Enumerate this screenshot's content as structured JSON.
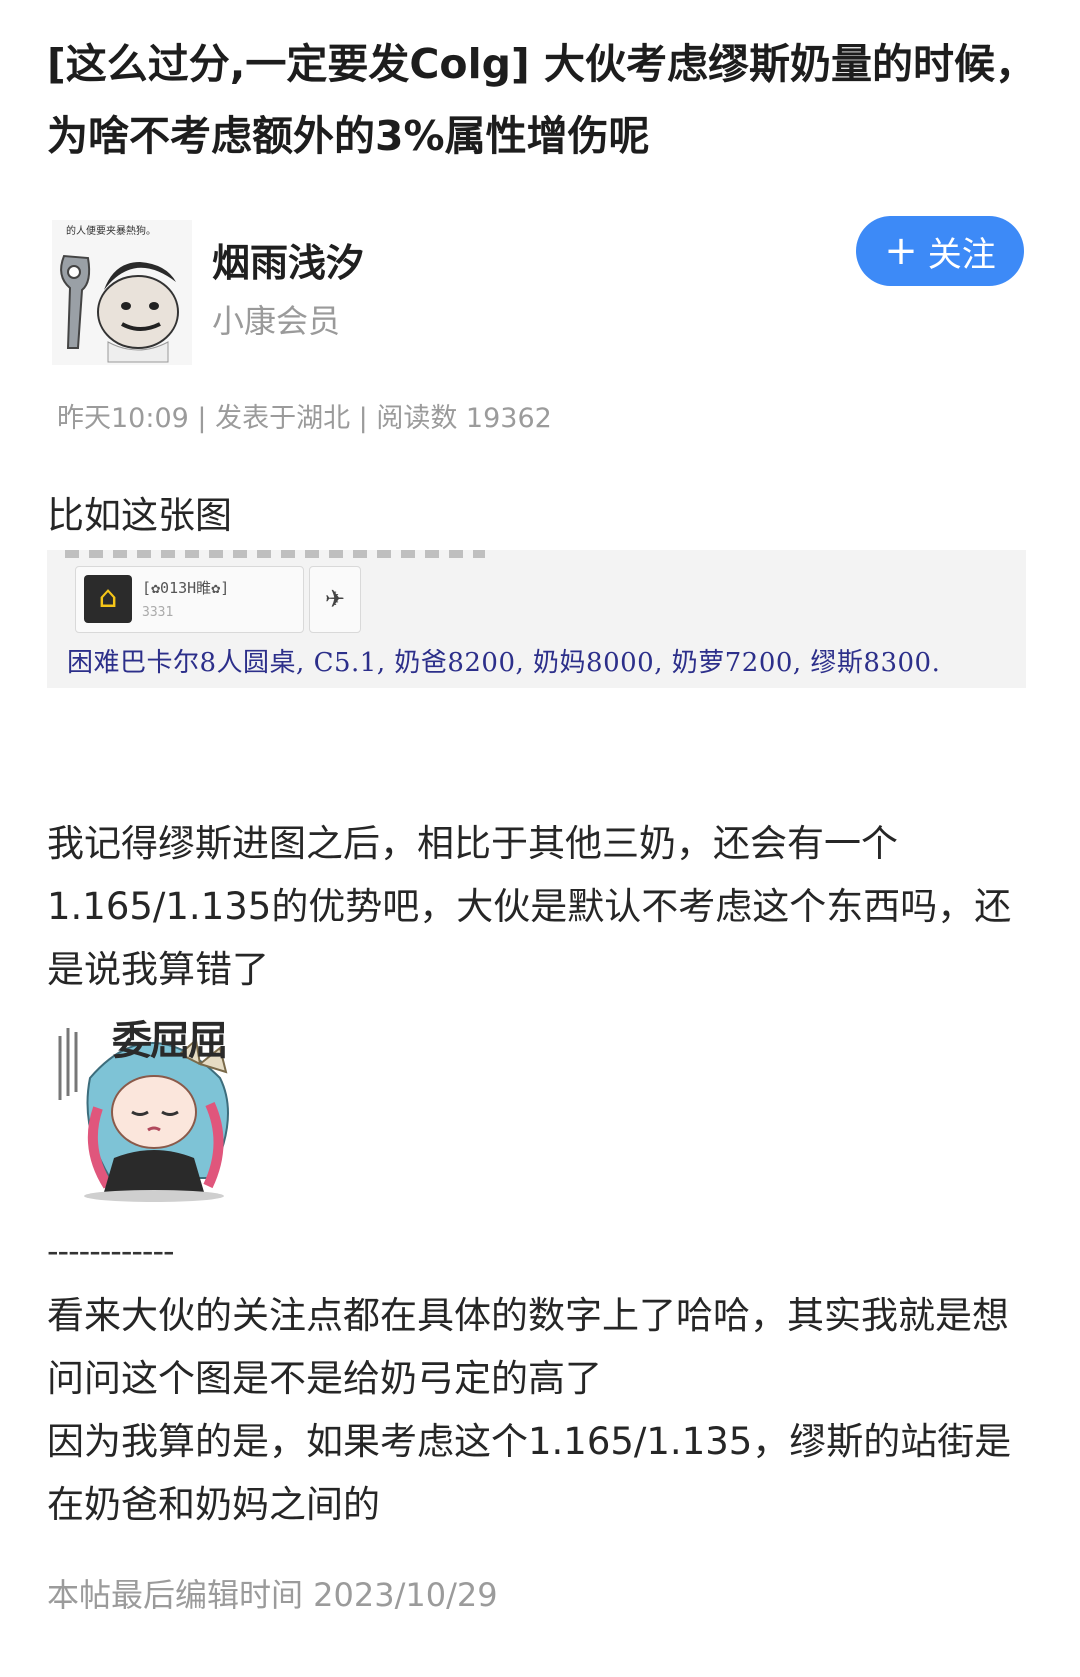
{
  "post": {
    "title": "[这么过分,一定要发Colg] 大伙考虑缪斯奶量的时候，为啥不考虑额外的3%属性增伤呢",
    "author": {
      "name": "烟雨浅汐",
      "level": "小康会员",
      "avatar_caption": "的人便要夹暴熱狗。"
    },
    "follow_label": "关注",
    "meta": "昨天10:09 | 发表于湖北 | 阅读数 19362",
    "paragraph_1": "比如这张图",
    "screenshot": {
      "chip_name": "[✿013H睢✿]",
      "chip_sub": "3331",
      "game_line": "困难巴卡尔8人圆桌, C5.1, 奶爸8200, 奶妈8000, 奶萝7200, 缪斯8300."
    },
    "paragraph_2": "我记得缪斯进图之后，相比于其他三奶，还会有一个1.165/1.135的优势吧，大伙是默认不考虑这个东西吗，还是说我算错了",
    "sticker_caption": "委屈屈",
    "divider": "------------",
    "paragraph_3_line_1": "看来大伙的关注点都在具体的数字上了哈哈，其实我就是想问问这个图是不是给奶弓定的高了",
    "paragraph_3_line_2": "因为我算的是，如果考虑这个1.165/1.135，缪斯的站街是在奶爸和奶妈之间的",
    "edit_time": "本帖最后编辑时间 2023/10/29"
  },
  "colors": {
    "accent": "#3d8af7",
    "muted_text": "#9b9b9b",
    "game_text": "#2c2f8a"
  },
  "icons": {
    "follow": "plus-icon",
    "screenshot_chip": "house-icon",
    "screenshot_action": "plane-icon"
  }
}
